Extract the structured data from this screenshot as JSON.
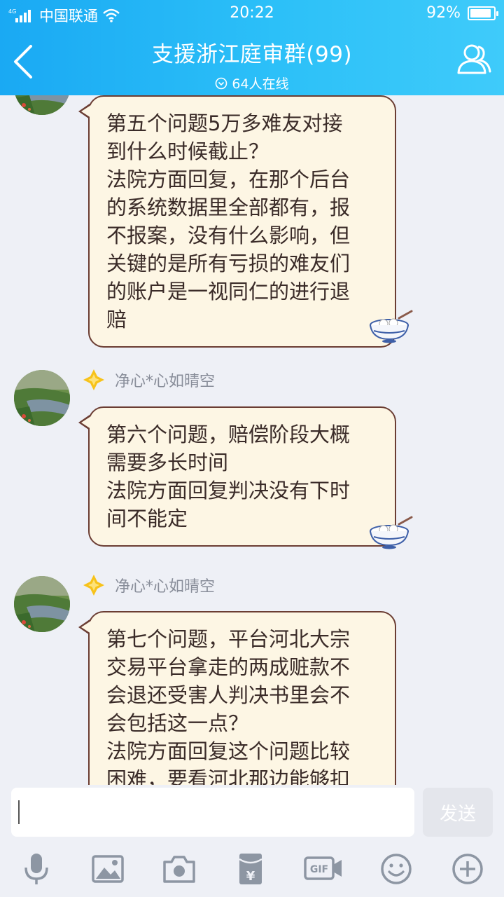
{
  "status_bar": {
    "network": "4G",
    "carrier": "中国联通",
    "time": "20:22",
    "battery_text": "92%",
    "battery_level": 0.92
  },
  "header": {
    "title": "支援浙江庭审群(99)",
    "online": "64人在线"
  },
  "messages": [
    {
      "lines": [
        "第五个问题5万多难友对接",
        "到什么时候截止？",
        "法院方面回复，在那个后台",
        "的系统数据里全部都有，报",
        "不报案，没有什么影响，但",
        "关键的是所有亏损的难友们",
        "的账户是一视同仁的进行退",
        "赔"
      ]
    },
    {
      "sender": "净心*心如晴空",
      "lines": [
        "第六个问题，赔偿阶段大概",
        "需要多长时间",
        "法院方面回复判决没有下时",
        "间不能定"
      ]
    },
    {
      "sender": "净心*心如晴空",
      "lines": [
        "第七个问题，平台河北大宗",
        "交易平台拿走的两成赃款不",
        "会退还受害人判决书里会不",
        "会包括这一点？",
        "法院方面回复这个问题比较",
        "困难，要看河北那边能够扣"
      ]
    }
  ],
  "input": {
    "value": "",
    "send_label": "发送"
  },
  "toolbar": {
    "icons": [
      "microphone-icon",
      "image-icon",
      "camera-icon",
      "red-packet-icon",
      "gif-icon",
      "emoji-icon",
      "plus-icon"
    ],
    "gif_label": "GIF",
    "yen_label": "¥"
  },
  "colors": {
    "header_start": "#1aa9f3",
    "header_end": "#3fcbfa",
    "bubble_bg": "#fdf6e4",
    "bubble_border": "#6b3d33",
    "sender_name": "#888d99",
    "badge": "#f7c21a"
  }
}
